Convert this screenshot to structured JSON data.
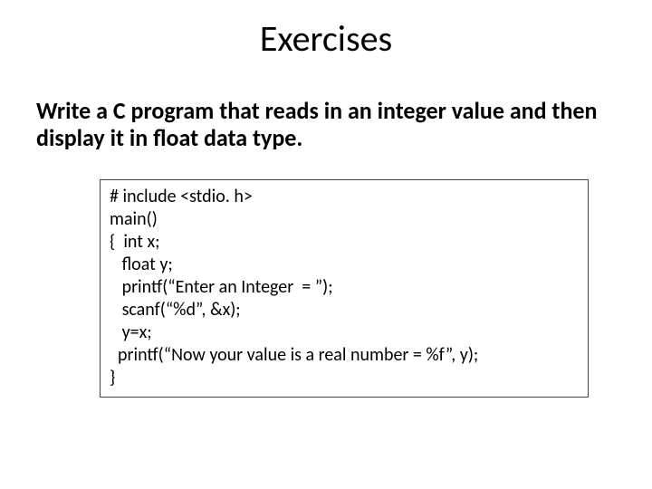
{
  "title": "Exercises",
  "prompt": "Write a C program that reads in an integer value and then display it in float data type.",
  "code": {
    "l1": "# include <stdio. h>",
    "l2": "main()",
    "l3": "{  int x;",
    "l4": "   float y;",
    "l5": "   printf(“Enter an Integer  = ”);",
    "l6": "   scanf(“%d”, &x);",
    "l7": "   y=x;",
    "l8": "  printf(“Now your value is a real number = %f”, y);",
    "l9": "}"
  }
}
